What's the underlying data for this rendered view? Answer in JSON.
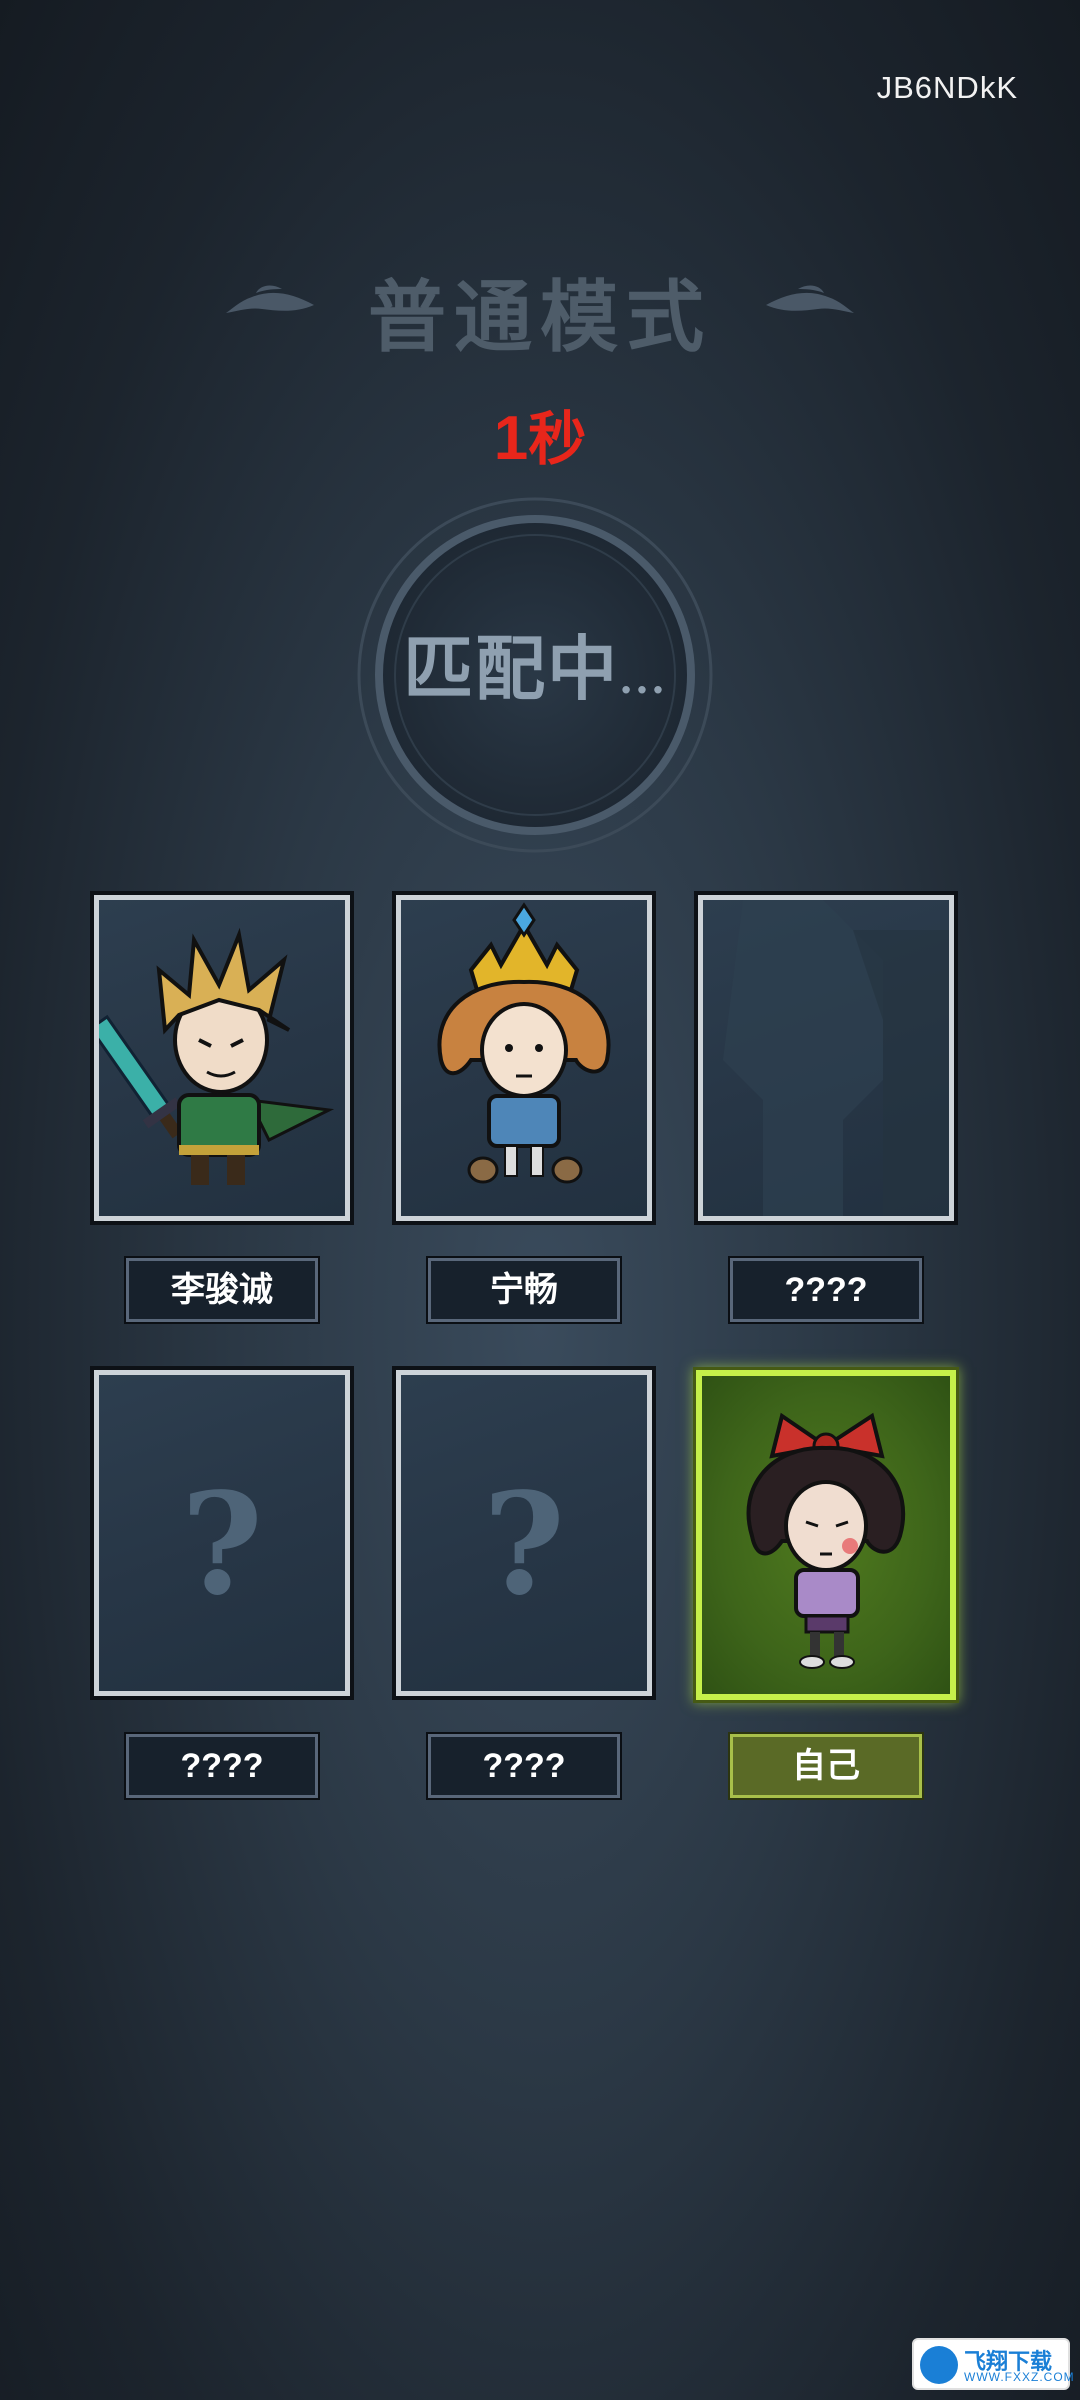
{
  "room_code": "JB6NDkK",
  "mode_title": "普通模式",
  "timer": {
    "value": "1",
    "unit": "秒"
  },
  "status": {
    "text": "匹配中",
    "dots": "..."
  },
  "players": [
    {
      "name": "李骏诚",
      "state": "joined",
      "character": "wilson"
    },
    {
      "name": "宁畅",
      "state": "joined",
      "character": "wendy-crown"
    },
    {
      "name": "????",
      "state": "loading"
    },
    {
      "name": "????",
      "state": "empty",
      "placeholder": "?"
    },
    {
      "name": "????",
      "state": "empty",
      "placeholder": "?"
    },
    {
      "name": "自己",
      "state": "self",
      "character": "willow-bow"
    }
  ],
  "colors": {
    "timer": "#e8261b",
    "self_highlight": "#c6f04a",
    "title": "#4e5c69"
  },
  "watermark": {
    "title": "飞翔下载",
    "subtitle": "WWW.FXXZ.COM"
  }
}
